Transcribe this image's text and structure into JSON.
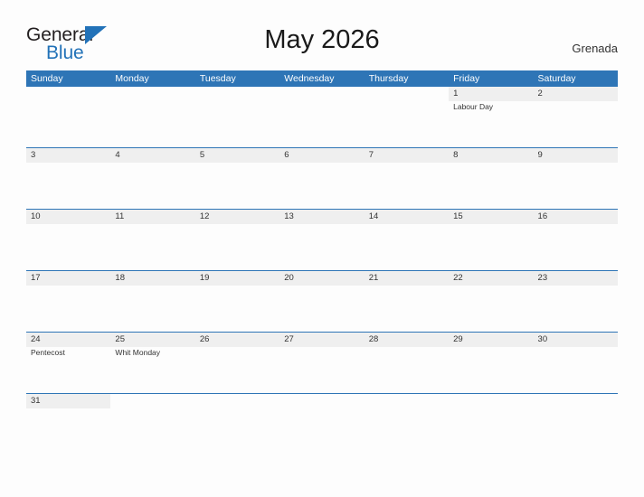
{
  "brand": {
    "name_part1": "General",
    "name_part2": "Blue",
    "flag_icon": "flag-triangle-icon",
    "accent_color": "#2272b8"
  },
  "header": {
    "title": "May 2026",
    "country": "Grenada"
  },
  "calendar": {
    "header_color": "#2e75b6",
    "band_color": "#efefef",
    "weekdays": [
      "Sunday",
      "Monday",
      "Tuesday",
      "Wednesday",
      "Thursday",
      "Friday",
      "Saturday"
    ],
    "weeks": [
      [
        {
          "day": "",
          "event": ""
        },
        {
          "day": "",
          "event": ""
        },
        {
          "day": "",
          "event": ""
        },
        {
          "day": "",
          "event": ""
        },
        {
          "day": "",
          "event": ""
        },
        {
          "day": "1",
          "event": "Labour Day"
        },
        {
          "day": "2",
          "event": ""
        }
      ],
      [
        {
          "day": "3",
          "event": ""
        },
        {
          "day": "4",
          "event": ""
        },
        {
          "day": "5",
          "event": ""
        },
        {
          "day": "6",
          "event": ""
        },
        {
          "day": "7",
          "event": ""
        },
        {
          "day": "8",
          "event": ""
        },
        {
          "day": "9",
          "event": ""
        }
      ],
      [
        {
          "day": "10",
          "event": ""
        },
        {
          "day": "11",
          "event": ""
        },
        {
          "day": "12",
          "event": ""
        },
        {
          "day": "13",
          "event": ""
        },
        {
          "day": "14",
          "event": ""
        },
        {
          "day": "15",
          "event": ""
        },
        {
          "day": "16",
          "event": ""
        }
      ],
      [
        {
          "day": "17",
          "event": ""
        },
        {
          "day": "18",
          "event": ""
        },
        {
          "day": "19",
          "event": ""
        },
        {
          "day": "20",
          "event": ""
        },
        {
          "day": "21",
          "event": ""
        },
        {
          "day": "22",
          "event": ""
        },
        {
          "day": "23",
          "event": ""
        }
      ],
      [
        {
          "day": "24",
          "event": "Pentecost"
        },
        {
          "day": "25",
          "event": "Whit Monday"
        },
        {
          "day": "26",
          "event": ""
        },
        {
          "day": "27",
          "event": ""
        },
        {
          "day": "28",
          "event": ""
        },
        {
          "day": "29",
          "event": ""
        },
        {
          "day": "30",
          "event": ""
        }
      ],
      [
        {
          "day": "31",
          "event": ""
        },
        {
          "day": "",
          "event": ""
        },
        {
          "day": "",
          "event": ""
        },
        {
          "day": "",
          "event": ""
        },
        {
          "day": "",
          "event": ""
        },
        {
          "day": "",
          "event": ""
        },
        {
          "day": "",
          "event": ""
        }
      ]
    ]
  }
}
